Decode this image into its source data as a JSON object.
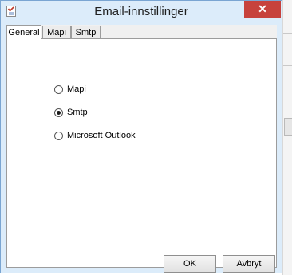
{
  "window": {
    "title": "Email-innstillinger",
    "close_label": "✕"
  },
  "tabs": [
    {
      "label": "General",
      "active": true
    },
    {
      "label": "Mapi",
      "active": false
    },
    {
      "label": "Smtp",
      "active": false
    }
  ],
  "options": [
    {
      "label": "Mapi",
      "selected": false
    },
    {
      "label": "Smtp",
      "selected": true
    },
    {
      "label": "Microsoft Outlook",
      "selected": false
    }
  ],
  "buttons": {
    "ok_label": "OK",
    "cancel_label": "Avbryt"
  },
  "colors": {
    "frame": "#dcecfa",
    "close_button": "#c7423c"
  }
}
